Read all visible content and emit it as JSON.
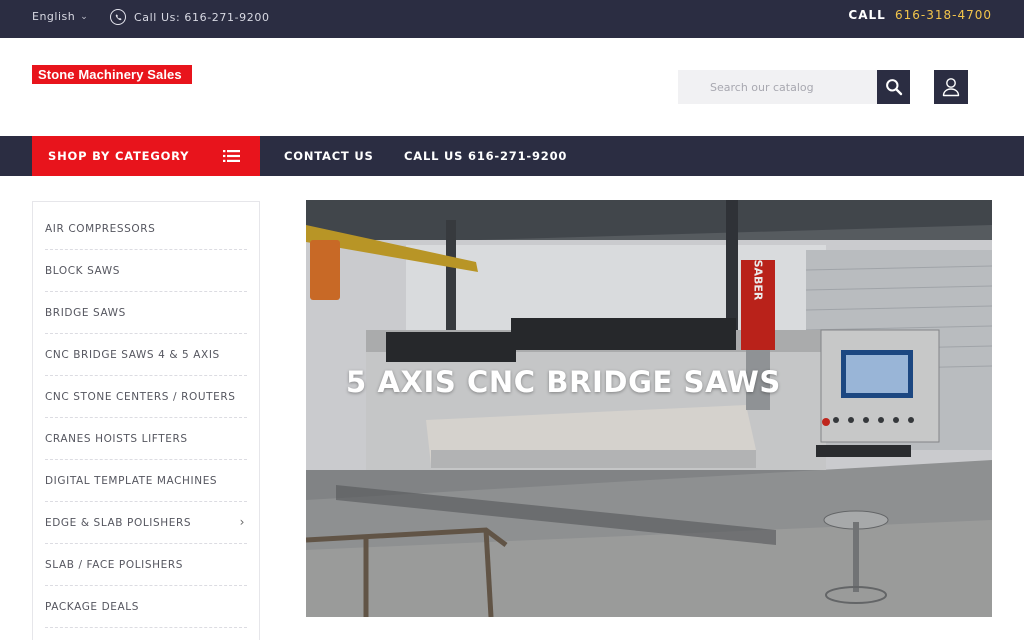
{
  "topbar": {
    "language": "English",
    "call_us": "Call Us: 616-271-9200",
    "call_label": "CALL",
    "call_number": "616-318-4700"
  },
  "header": {
    "logo_text": "Stone Machinery Sales",
    "search_placeholder": "Search our catalog"
  },
  "nav": {
    "shop_by_category": "SHOP BY CATEGORY",
    "contact_us": "CONTACT US",
    "call_us": "CALL US 616-271-9200"
  },
  "sidebar": {
    "items": [
      {
        "label": "AIR COMPRESSORS"
      },
      {
        "label": "BLOCK SAWS"
      },
      {
        "label": "BRIDGE SAWS"
      },
      {
        "label": "CNC BRIDGE SAWS 4 & 5 AXIS"
      },
      {
        "label": "CNC STONE CENTERS / ROUTERS"
      },
      {
        "label": "CRANES HOISTS LIFTERS"
      },
      {
        "label": "DIGITAL TEMPLATE MACHINES"
      },
      {
        "label": "EDGE & SLAB POLISHERS",
        "has_submenu": true
      },
      {
        "label": "SLAB / FACE POLISHERS"
      },
      {
        "label": "PACKAGE DEALS"
      }
    ]
  },
  "banner": {
    "title": "5 AXIS CNC BRIDGE SAWS",
    "machine_label": "SABER",
    "panel_label": "SABER"
  },
  "icons": {
    "language_chevron": "chevron-down-icon",
    "whatsapp": "whatsapp-icon",
    "search": "search-icon",
    "account": "user-icon",
    "category_list": "list-icon",
    "submenu_arrow": "chevron-right-icon"
  },
  "colors": {
    "dark_navy": "#2b2d42",
    "brand_red": "#e8141c",
    "call_number": "#f3c54b"
  }
}
